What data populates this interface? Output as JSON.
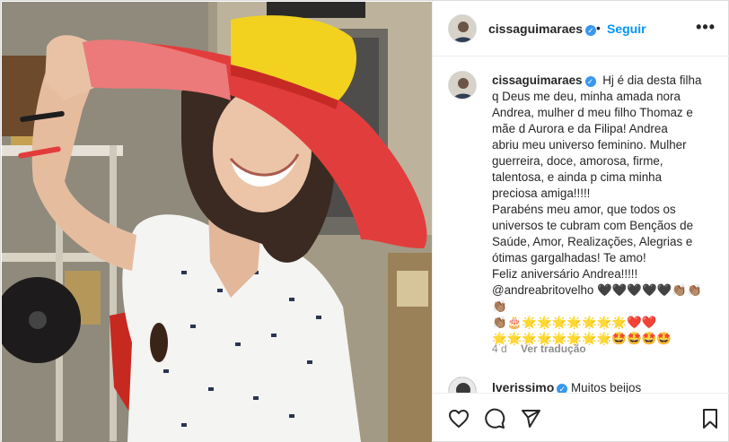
{
  "post": {
    "author": "cissaguimaraes",
    "verified_mark": "✓",
    "separator": "•",
    "follow_label": "Seguir",
    "more_label": "•••",
    "caption_lines": [
      "Hj é dia desta filha",
      "q Deus me deu, minha amada nora",
      "Andrea, mulher d meu filho Thomaz e",
      "mãe d Aurora e da Filipa! Andrea",
      "abriu meu universo feminino. Mulher",
      "guerreira, doce, amorosa, firme,",
      "talentosa, e ainda p cima minha",
      "preciosa amiga!!!!!",
      "Parabéns meu amor, que todos os",
      "universos te cubram com Bençãos de",
      "Saúde, Amor, Realizações, Alegrias e",
      "ótimas gargalhadas! Te amo!",
      "Feliz aniversário Andrea!!!!!",
      "@andreabritovelho 🖤🖤🖤🖤🖤👏🏽👏🏽👏🏽",
      "👏🏽🎂🌟🌟🌟🌟🌟🌟🌟❤️❤️",
      "🌟🌟🌟🌟🌟🌟🌟🌟🤩🤩🤩🤩"
    ],
    "time_ago": "4 d",
    "translate_label": "Ver tradução"
  },
  "comment": {
    "author": "lverissimo",
    "text": "Muitos beijos"
  },
  "colors": {
    "accent": "#0095f6",
    "verified": "#3897f0",
    "muted": "#8e8e8e"
  },
  "icons": [
    "heart-icon",
    "comment-icon",
    "share-icon",
    "bookmark-icon",
    "more-options-icon",
    "verified-icon"
  ]
}
